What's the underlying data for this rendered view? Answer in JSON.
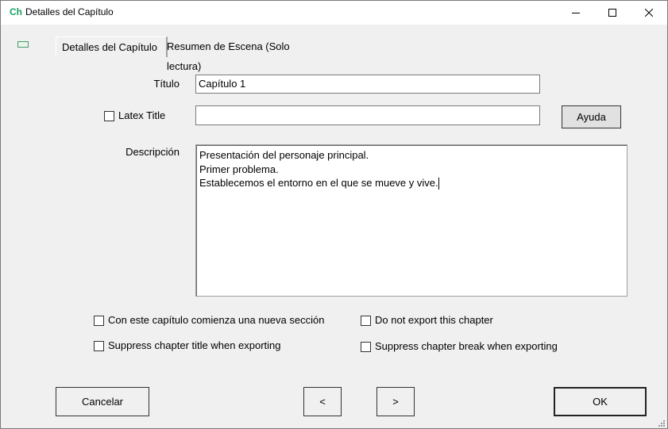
{
  "window": {
    "app_icon_text": "Ch",
    "title": "Detalles del Capítulo",
    "controls": {
      "minimize": "minimize-icon",
      "maximize": "maximize-icon",
      "close": "close-icon"
    }
  },
  "tabs": [
    {
      "label": "Detalles del Capítulo",
      "active": true
    },
    {
      "label": "Resumen de Escena (Solo lectura)",
      "active": false
    }
  ],
  "form": {
    "titulo_label": "Título",
    "titulo_value": "Capítulo 1",
    "latex_title_label": "Latex Title",
    "latex_title_checked": false,
    "latex_title_value": "",
    "ayuda_button": "Ayuda",
    "descripcion_label": "Descripción",
    "descripcion_value": "Presentación del personaje principal.\nPrimer problema.\nEstablecemos el entorno en el que se mueve y vive."
  },
  "options": {
    "new_section": {
      "label": "Con este capítulo comienza una nueva sección",
      "checked": false
    },
    "suppress_title": {
      "label": "Suppress chapter title when exporting",
      "checked": false
    },
    "no_export": {
      "label": "Do not export this chapter",
      "checked": false
    },
    "suppress_break": {
      "label": "Suppress chapter break when exporting",
      "checked": false
    }
  },
  "buttons": {
    "cancel": "Cancelar",
    "prev": "<",
    "next": ">",
    "ok": "OK"
  },
  "colors": {
    "background": "#f0f0f0",
    "app_icon": "#1aa260"
  }
}
